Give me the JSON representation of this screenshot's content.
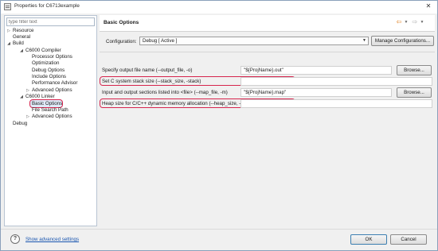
{
  "window": {
    "title": "Properties for C6713example",
    "close_glyph": "✕"
  },
  "filter": {
    "placeholder": "type filter text"
  },
  "tree": [
    {
      "label": "Resource",
      "twisty": "▷"
    },
    {
      "label": "General",
      "twisty": ""
    },
    {
      "label": "Build",
      "twisty": "◢"
    },
    {
      "label": "C6000 Compiler",
      "twisty": "◢"
    },
    {
      "label": "Processor Options",
      "twisty": ""
    },
    {
      "label": "Optimization",
      "twisty": ""
    },
    {
      "label": "Debug Options",
      "twisty": ""
    },
    {
      "label": "Include Options",
      "twisty": ""
    },
    {
      "label": "Performance Advisor",
      "twisty": ""
    },
    {
      "label": "Advanced Options",
      "twisty": "▷"
    },
    {
      "label": "C6000 Linker",
      "twisty": "◢"
    },
    {
      "label": "Basic Options",
      "twisty": ""
    },
    {
      "label": "File Search Path",
      "twisty": ""
    },
    {
      "label": "Advanced Options",
      "twisty": "▷"
    },
    {
      "label": "Debug",
      "twisty": ""
    }
  ],
  "header": {
    "title": "Basic Options",
    "icons": [
      "back-arrow-icon",
      "dropdown-icon",
      "forward-arrow-icon",
      "dropdown-icon"
    ]
  },
  "configuration": {
    "label": "Configuration:",
    "value": "Debug  [ Active ]",
    "manage_button": "Manage Configurations..."
  },
  "options": [
    {
      "label": "Specify output file name (--output_file, -o)",
      "value": "\"${ProjName}.out\"",
      "browse": "Browse..."
    },
    {
      "label": "Set C system stack size (--stack_size, -stack)",
      "value": ""
    },
    {
      "label": "Input and output sections listed into <file> (--map_file, -m)",
      "value": "\"${ProjName}.map\"",
      "browse": "Browse..."
    },
    {
      "label": "Heap size for C/C++ dynamic memory allocation (--heap_size, -heap)",
      "value": ""
    }
  ],
  "bottom": {
    "help_glyph": "?",
    "advanced_link": "Show advanced settings",
    "ok": "OK",
    "cancel": "Cancel"
  },
  "colors": {
    "highlight": "#d6244d",
    "selection": "#dfe9f7",
    "link": "#1a56b0",
    "accent_arrow": "#e07a16"
  }
}
